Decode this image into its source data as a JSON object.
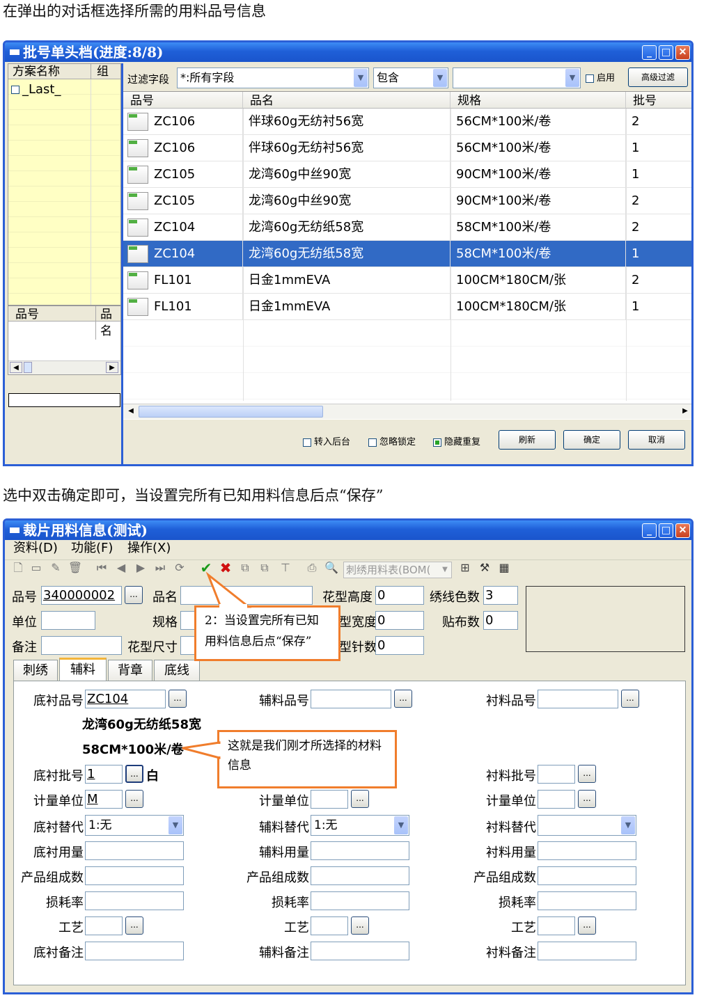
{
  "captions": {
    "top": "在弹出的对话框选择所需的用料品号信息",
    "middle": "选中双击确定即可，当设置完所有已知用料信息后点“保存”"
  },
  "dialog1": {
    "title": "批号单头档(进度:8/8)",
    "left_panel": {
      "headers": [
        "方案名称",
        "组"
      ],
      "item": "_Last_",
      "bottom_headers": [
        "品号",
        "品名"
      ]
    },
    "filter": {
      "label": "过滤字段",
      "field": "*:所有字段",
      "op": "包含",
      "value": "",
      "enable_label": "启用",
      "advanced_button": "高级过滤"
    },
    "columns": [
      "品号",
      "品名",
      "规格",
      "批号"
    ],
    "rows": [
      {
        "code": "ZC106",
        "name": "伴球60g无纺衬56宽",
        "spec": "56CM*100米/卷",
        "batch": "2"
      },
      {
        "code": "ZC106",
        "name": "伴球60g无纺衬56宽",
        "spec": "56CM*100米/卷",
        "batch": "1"
      },
      {
        "code": "ZC105",
        "name": "龙湾60g中丝90宽",
        "spec": "90CM*100米/卷",
        "batch": "1"
      },
      {
        "code": "ZC105",
        "name": "龙湾60g中丝90宽",
        "spec": "90CM*100米/卷",
        "batch": "2"
      },
      {
        "code": "ZC104",
        "name": "龙湾60g无纺纸58宽",
        "spec": "58CM*100米/卷",
        "batch": "2"
      },
      {
        "code": "ZC104",
        "name": "龙湾60g无纺纸58宽",
        "spec": "58CM*100米/卷",
        "batch": "1"
      },
      {
        "code": "FL101",
        "name": "日金1mmEVA",
        "spec": "100CM*180CM/张",
        "batch": "2"
      },
      {
        "code": "FL101",
        "name": "日金1mmEVA",
        "spec": "100CM*180CM/张",
        "batch": "1"
      }
    ],
    "selected_row": 5,
    "footer": {
      "to_background": "转入后台",
      "ignore_lock": "忽略锁定",
      "hide_dup": "隐藏重复",
      "refresh": "刷新",
      "ok": "确定",
      "cancel": "取消"
    }
  },
  "dialog2": {
    "title": "裁片用料信息(测试)",
    "menu": [
      "资料(D)",
      "功能(F)",
      "操作(X)"
    ],
    "bom_combo": "刺绣用料表(BOM(",
    "header": {
      "pn_label": "品号",
      "pn_value": "340000002",
      "name_label": "品名",
      "unit_label": "单位",
      "spec_label": "规格",
      "note_label": "备注",
      "size_label": "花型尺寸",
      "height_label": "花型高度",
      "height_value": "0",
      "width_label": "型宽度",
      "width_value": "0",
      "stitch_label": "型针数",
      "stitch_value": "0",
      "colors_label": "绣线色数",
      "colors_value": "3",
      "patch_label": "贴布数",
      "patch_value": "0"
    },
    "tabs": [
      "刺绣",
      "辅料",
      "背章",
      "底线"
    ],
    "active_tab": 1,
    "col1": {
      "pn_label": "底衬品号",
      "pn_value": "ZC104",
      "desc_name": "龙湾60g无纺纸58宽",
      "desc_spec": "58CM*100米/卷",
      "batch_label": "底衬批号",
      "batch_value": "1",
      "batch_suffix": "白",
      "unit_label": "计量单位",
      "unit_value": "M",
      "sub_label": "底衬替代",
      "sub_value": "1:无",
      "usage_label": "底衬用量",
      "comp_label": "产品组成数",
      "loss_label": "损耗率",
      "craft_label": "工艺",
      "remark_label": "底衬备注"
    },
    "col2": {
      "pn_label": "辅料品号",
      "unit_label": "计量单位",
      "sub_label": "辅料替代",
      "sub_value": "1:无",
      "usage_label": "辅料用量",
      "comp_label": "产品组成数",
      "loss_label": "损耗率",
      "craft_label": "工艺",
      "remark_label": "辅料备注"
    },
    "col3": {
      "pn_label": "衬料品号",
      "batch_label": "衬料批号",
      "unit_label": "计量单位",
      "sub_label": "衬料替代",
      "sub_value": "",
      "usage_label": "衬料用量",
      "comp_label": "产品组成数",
      "loss_label": "损耗率",
      "craft_label": "工艺",
      "remark_label": "衬料备注"
    },
    "callouts": {
      "save": "2：当设置完所有已知用料信息后点“保存”",
      "selected": "这就是我们刚才所选择的材料信息"
    }
  },
  "colors": {
    "accent": "#316ac5",
    "title": "#1f5fd8",
    "callout": "#f07d2c",
    "left_panel": "#ffffc4"
  }
}
